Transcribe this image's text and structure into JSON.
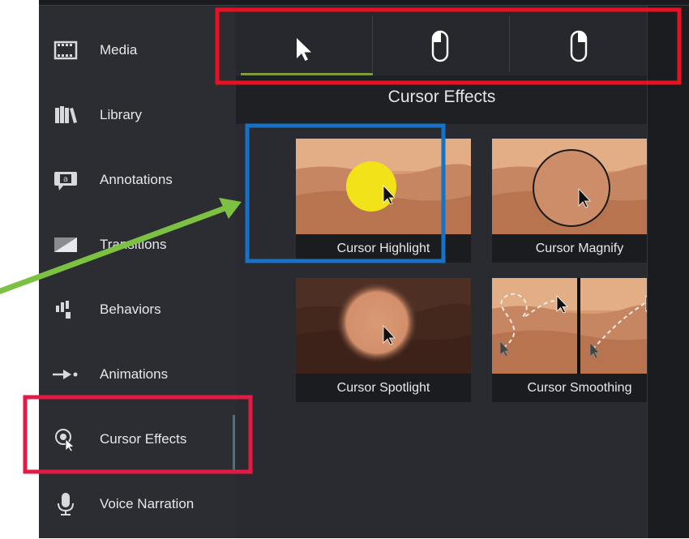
{
  "sidebar": {
    "items": [
      {
        "label": "Media",
        "icon": "film-icon"
      },
      {
        "label": "Library",
        "icon": "books-icon"
      },
      {
        "label": "Annotations",
        "icon": "annotation-icon"
      },
      {
        "label": "Transitions",
        "icon": "transition-icon"
      },
      {
        "label": "Behaviors",
        "icon": "behaviors-icon"
      },
      {
        "label": "Animations",
        "icon": "animation-arrow-icon"
      },
      {
        "label": "Cursor Effects",
        "icon": "cursor-effects-icon",
        "active": true
      },
      {
        "label": "Voice Narration",
        "icon": "microphone-icon"
      }
    ]
  },
  "tabs": [
    {
      "icon": "cursor-arrow-icon",
      "selected": true
    },
    {
      "icon": "mouse-left-click-icon"
    },
    {
      "icon": "mouse-right-click-icon"
    }
  ],
  "panel": {
    "title": "Cursor Effects",
    "effects": [
      {
        "label": "Cursor Highlight"
      },
      {
        "label": "Cursor Magnify"
      },
      {
        "label": "Cursor Spotlight"
      },
      {
        "label": "Cursor Smoothing"
      }
    ]
  },
  "colors": {
    "sidebar_bg": "#2b2d32",
    "panel_bg": "#292b30",
    "header_bg": "#1f2024",
    "tab_underline": "#7e9c3c",
    "highlight_yellow": "#f2e21a",
    "annotation_red": "#e81123",
    "annotation_blue": "#1672c4",
    "annotation_green": "#7cc142"
  }
}
